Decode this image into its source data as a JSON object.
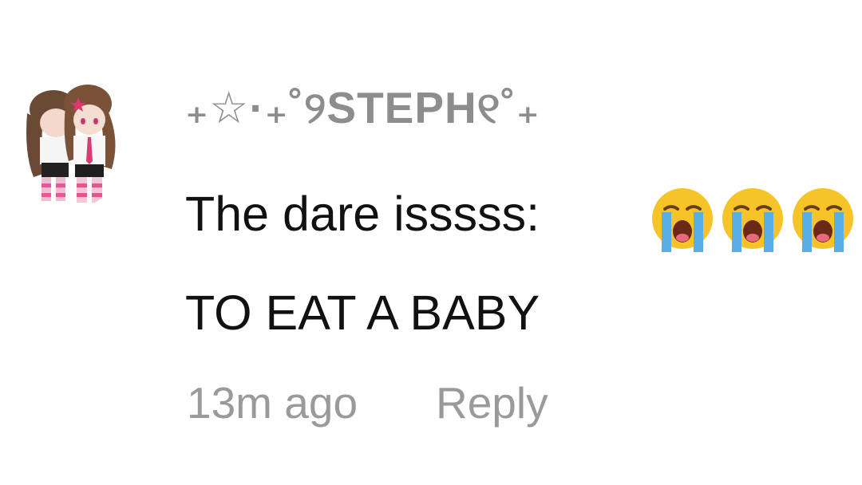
{
  "comment": {
    "username": "₊☆·₊˚୨STEPH୧˚₊",
    "text_line1": "The dare isssss:",
    "emojis": [
      "loudly-crying-face-icon",
      "loudly-crying-face-icon",
      "loudly-crying-face-icon"
    ],
    "text_line2": "TO EAT A BABY",
    "timestamp": "13m ago",
    "reply_label": "Reply"
  },
  "colors": {
    "username": "#8d8d8d",
    "body_text": "#111111",
    "meta_text": "#9a9a9a",
    "emoji_face": "#f6c428",
    "emoji_tears": "#5aaee6"
  }
}
